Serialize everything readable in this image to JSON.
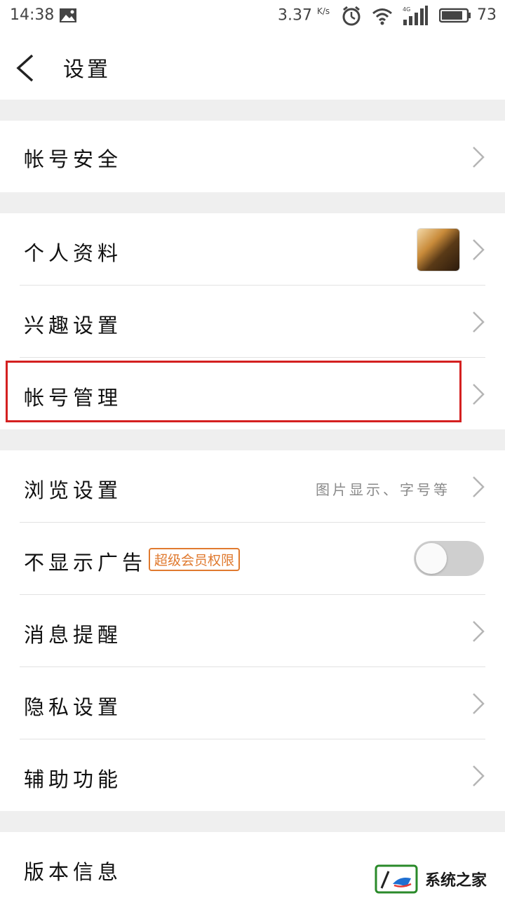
{
  "status_bar": {
    "time": "14:38",
    "speed_value": "3.37",
    "speed_unit": "K/s",
    "battery": "73"
  },
  "header": {
    "title": "设置"
  },
  "sections": {
    "account_security": "帐号安全",
    "profile": "个人资料",
    "interest_settings": "兴趣设置",
    "account_management": "帐号管理",
    "browse_settings": "浏览设置",
    "browse_hint": "图片显示、字号等",
    "no_ads": "不显示广告",
    "vip_badge": "超级会员权限",
    "no_ads_enabled": false,
    "notifications": "消息提醒",
    "privacy": "隐私设置",
    "accessibility": "辅助功能",
    "version_info": "版本信息"
  },
  "watermark": {
    "text": "系统之家"
  },
  "colors": {
    "accent": "#d42020",
    "badge": "#e07a2f",
    "section_gap": "#efefef"
  }
}
